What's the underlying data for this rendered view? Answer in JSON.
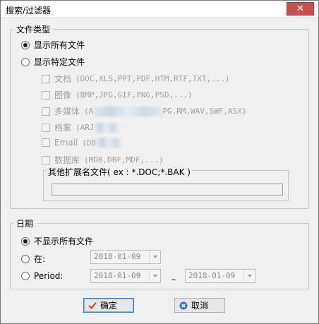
{
  "window": {
    "title": "搜索/过滤器",
    "close_glyph": "✕"
  },
  "file_type": {
    "legend": "文件类型",
    "show_all_label": "显示所有文件",
    "show_specific_label": "显示特定文件",
    "categories": [
      {
        "name": "文档",
        "ext": "(DOC,XLS,PPT,PDF,HTM,RTF,TXT,...)"
      },
      {
        "name": "图像",
        "ext": "(BMP,JPG,GIF,PNG,PSD,...)"
      },
      {
        "name": "多媒体",
        "ext_prefix": "(A",
        "ext_suffix": "PG,RM,WAV,SWF,ASX)"
      },
      {
        "name": "档案",
        "ext_prefix": "(ARJ",
        "ext_suffix": ""
      },
      {
        "name": "Email",
        "ext_prefix": "(DB",
        "ext_suffix": ""
      },
      {
        "name": "数据库",
        "ext": "(MDB,DBF,MDF,...)"
      }
    ],
    "other_ext_label": "其他扩展名文件( ex : *.DOC;*.BAK )",
    "other_ext_value": ""
  },
  "date": {
    "legend": "日期",
    "no_date_label": "不显示所有文件",
    "on_label": "在:",
    "period_label": "Period:",
    "on_value": "2018-01-09",
    "period_from": "2018-01-09",
    "period_to": "2018-01-09",
    "dash": "–"
  },
  "buttons": {
    "ok_label": "确定",
    "cancel_label": "取消"
  }
}
